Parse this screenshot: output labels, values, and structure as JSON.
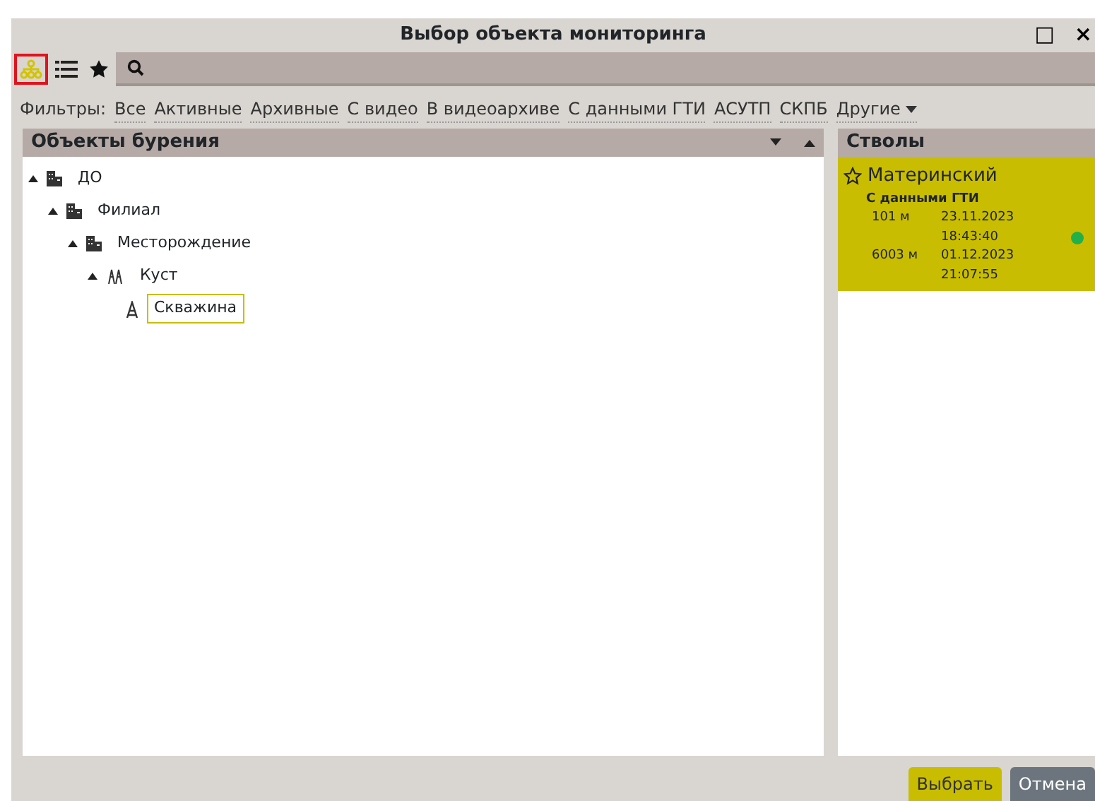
{
  "window": {
    "title": "Выбор объекта мониторинга",
    "controls": [
      "□",
      "×"
    ]
  },
  "toolbar": {
    "views": [
      {
        "kind": "tree",
        "selected": true
      },
      {
        "kind": "list",
        "selected": false
      },
      {
        "kind": "favorites",
        "selected": false
      }
    ]
  },
  "filters": {
    "label": "Фильтры:",
    "items": [
      "Все",
      "Активные",
      "Архивные",
      "С видео",
      "В видеоархиве",
      "С данными ГТИ",
      "АСУТП",
      "СКПБ"
    ],
    "more": "Другие"
  },
  "tree_panel": {
    "title": "Объекты бурения",
    "nodes": [
      {
        "label": "ДО",
        "kind": "org",
        "expanded": true,
        "selected": false,
        "children": [
          {
            "label": "Филиал",
            "kind": "org",
            "expanded": true,
            "selected": false,
            "children": [
              {
                "label": "Месторождение",
                "kind": "org",
                "expanded": true,
                "selected": false,
                "children": [
                  {
                    "label": "Куст",
                    "kind": "pad",
                    "expanded": true,
                    "selected": false,
                    "children": [
                      {
                        "label": "Скважина",
                        "kind": "well",
                        "selected": true
                      }
                    ]
                  }
                ]
              }
            ]
          }
        ]
      }
    ]
  },
  "bores_panel": {
    "title": "Стволы",
    "items": [
      {
        "name": "Материнский",
        "favorite": false,
        "selected": true,
        "tag": "С данными ГТИ",
        "color": "#22b04b",
        "rows": [
          {
            "depth": "101 м",
            "time": "23.11.2023 18:43:40"
          },
          {
            "depth": "6003 м",
            "time": "01.12.2023 21:07:55"
          }
        ]
      }
    ]
  },
  "buttons": [
    {
      "label": "Выбрать",
      "kind": "primary"
    },
    {
      "label": "Отмена",
      "kind": "secondary"
    }
  ]
}
